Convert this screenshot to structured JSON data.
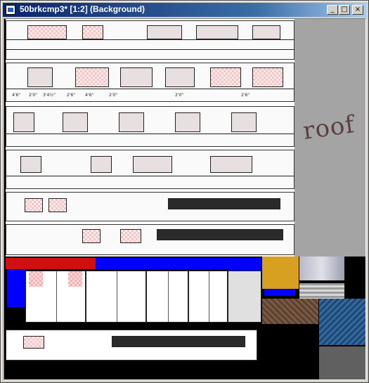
{
  "window": {
    "title": "50brkcmp3* [1:2] (Background)",
    "buttons": {
      "minimize": "_",
      "maximize": "□",
      "close": "×"
    }
  },
  "canvas": {
    "annotation": "roof",
    "dimensions_row": [
      "4'6\"",
      "2'0\"",
      "3'4½\"",
      "2'6\"",
      "4'6\"",
      "2'0\"",
      "2'0\"",
      "2'6\""
    ],
    "colors": {
      "blue": "#0000ff",
      "red": "#d01010",
      "pink": "#f3c7c7",
      "gray": "#a4a4a4"
    }
  }
}
